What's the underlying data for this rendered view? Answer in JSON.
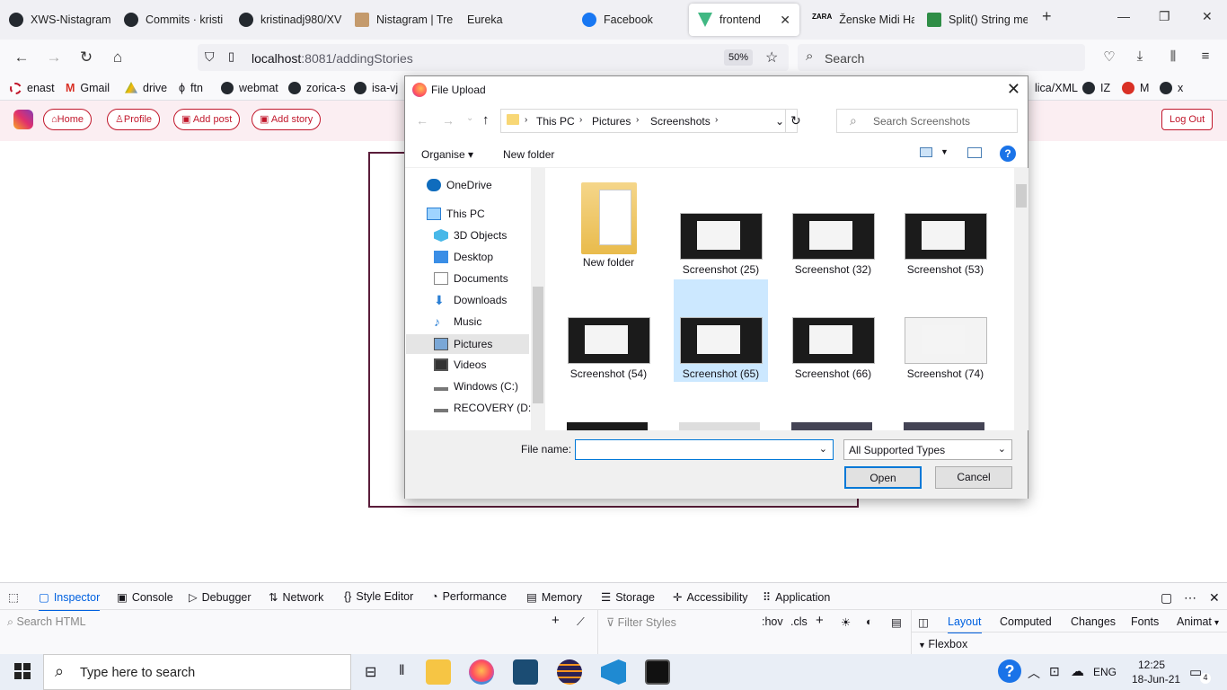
{
  "browser": {
    "tabs": [
      {
        "label": "XWS-Nistagram",
        "icon": "github-icon"
      },
      {
        "label": "Commits · kristi",
        "icon": "github-icon"
      },
      {
        "label": "kristinadj980/XV",
        "icon": "github-icon"
      },
      {
        "label": "Nistagram | Tre",
        "icon": "trello-icon"
      },
      {
        "label": "Eureka",
        "icon": "eureka-icon"
      },
      {
        "label": "Facebook",
        "icon": "facebook-icon"
      },
      {
        "label": "frontend",
        "icon": "vue-icon",
        "active": true
      },
      {
        "label": "Ženske Midi Ha",
        "icon": "zara-icon"
      },
      {
        "label": "Split() String me",
        "icon": "gfg-icon"
      }
    ],
    "url_host": "localhost",
    "url_rest": ":8081/addingStories",
    "zoom": "50%",
    "search_placeholder": "Search",
    "bookmarks": [
      "enast",
      "Gmail",
      "drive",
      "ftn",
      "webmat",
      "zorica-s",
      "isa-vj",
      "lica/XML",
      "IZ",
      "M",
      "x"
    ]
  },
  "app": {
    "nav": [
      "Home",
      "Profile",
      "Add post",
      "Add story"
    ],
    "logout": "Log Out"
  },
  "dialog": {
    "title": "File Upload",
    "breadcrumb": [
      "This PC",
      "Pictures",
      "Screenshots"
    ],
    "search_placeholder": "Search Screenshots",
    "organise": "Organise",
    "new_folder": "New folder",
    "tree": [
      {
        "label": "OneDrive",
        "indent": 0
      },
      {
        "label": "This PC",
        "indent": 0
      },
      {
        "label": "3D Objects",
        "indent": 1
      },
      {
        "label": "Desktop",
        "indent": 1
      },
      {
        "label": "Documents",
        "indent": 1
      },
      {
        "label": "Downloads",
        "indent": 1
      },
      {
        "label": "Music",
        "indent": 1
      },
      {
        "label": "Pictures",
        "indent": 1,
        "selected": true
      },
      {
        "label": "Videos",
        "indent": 1
      },
      {
        "label": "Windows (C:)",
        "indent": 1
      },
      {
        "label": "RECOVERY (D:)",
        "indent": 1
      }
    ],
    "files": [
      {
        "label": "New folder",
        "type": "folder"
      },
      {
        "label": "Screenshot (25)",
        "type": "image"
      },
      {
        "label": "Screenshot (32)",
        "type": "image"
      },
      {
        "label": "Screenshot (53)",
        "type": "image"
      },
      {
        "label": "Screenshot (54)",
        "type": "image"
      },
      {
        "label": "Screenshot (65)",
        "type": "image",
        "selected": true
      },
      {
        "label": "Screenshot (66)",
        "type": "image"
      },
      {
        "label": "Screenshot (74)",
        "type": "image"
      }
    ],
    "file_name_label": "File name:",
    "file_name_value": "",
    "file_type": "All Supported Types",
    "open": "Open",
    "cancel": "Cancel"
  },
  "devtools": {
    "tabs": [
      "Inspector",
      "Console",
      "Debugger",
      "Network",
      "Style Editor",
      "Performance",
      "Memory",
      "Storage",
      "Accessibility",
      "Application"
    ],
    "search_html": "Search HTML",
    "filter_styles": "Filter Styles",
    "hov": ":hov",
    "cls": ".cls",
    "side_tabs": [
      "Layout",
      "Computed",
      "Changes",
      "Fonts",
      "Animat"
    ],
    "flexbox": "Flexbox"
  },
  "taskbar": {
    "search": "Type here to search",
    "lang": "ENG",
    "time": "12:25",
    "date": "18-Jun-21",
    "notifications": "4"
  }
}
